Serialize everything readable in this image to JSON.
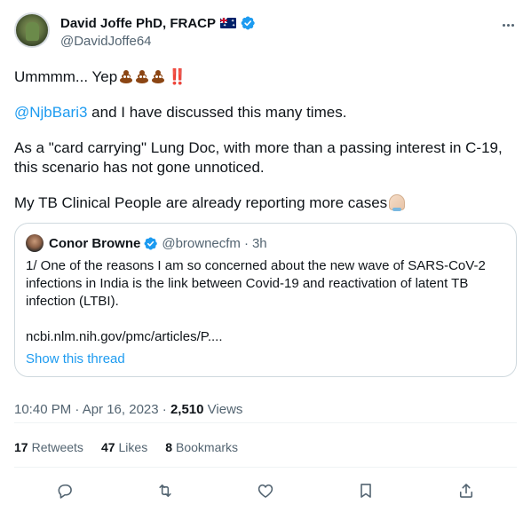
{
  "author": {
    "display_name": "David Joffe PhD, FRACP",
    "handle": "@DavidJoffe64",
    "flag": "australia-flag"
  },
  "tweet": {
    "line1_text": "Ummmm... Yep",
    "line1_bangs": "‼️",
    "mention": "@NjbBari3",
    "line2_rest": " and I have discussed this many times.",
    "para3": "As a \"card carrying\" Lung Doc, with more than a passing interest in C-19, this scenario has not gone unnoticed.",
    "para4": "My TB Clinical People are already reporting more cases"
  },
  "quoted": {
    "display_name": "Conor Browne",
    "handle": "@brownecfm",
    "separator": "·",
    "time": "3h",
    "text": "1/ One of the reasons I am so concerned about the new wave of SARS-CoV-2 infections in India is the link between Covid-19 and reactivation of latent TB infection (LTBI).",
    "link": "ncbi.nlm.nih.gov/pmc/articles/P....",
    "show_thread": "Show this thread"
  },
  "meta": {
    "time": "10:40 PM · Apr 16, 2023 · ",
    "views_count": "2,510",
    "views_label": "Views"
  },
  "stats": {
    "retweets_count": "17",
    "retweets_label": "Retweets",
    "likes_count": "47",
    "likes_label": "Likes",
    "bookmarks_count": "8",
    "bookmarks_label": "Bookmarks"
  },
  "colors": {
    "accent": "#1d9bf0",
    "text": "#0f1419",
    "secondary": "#536471",
    "border": "#cfd9de"
  }
}
